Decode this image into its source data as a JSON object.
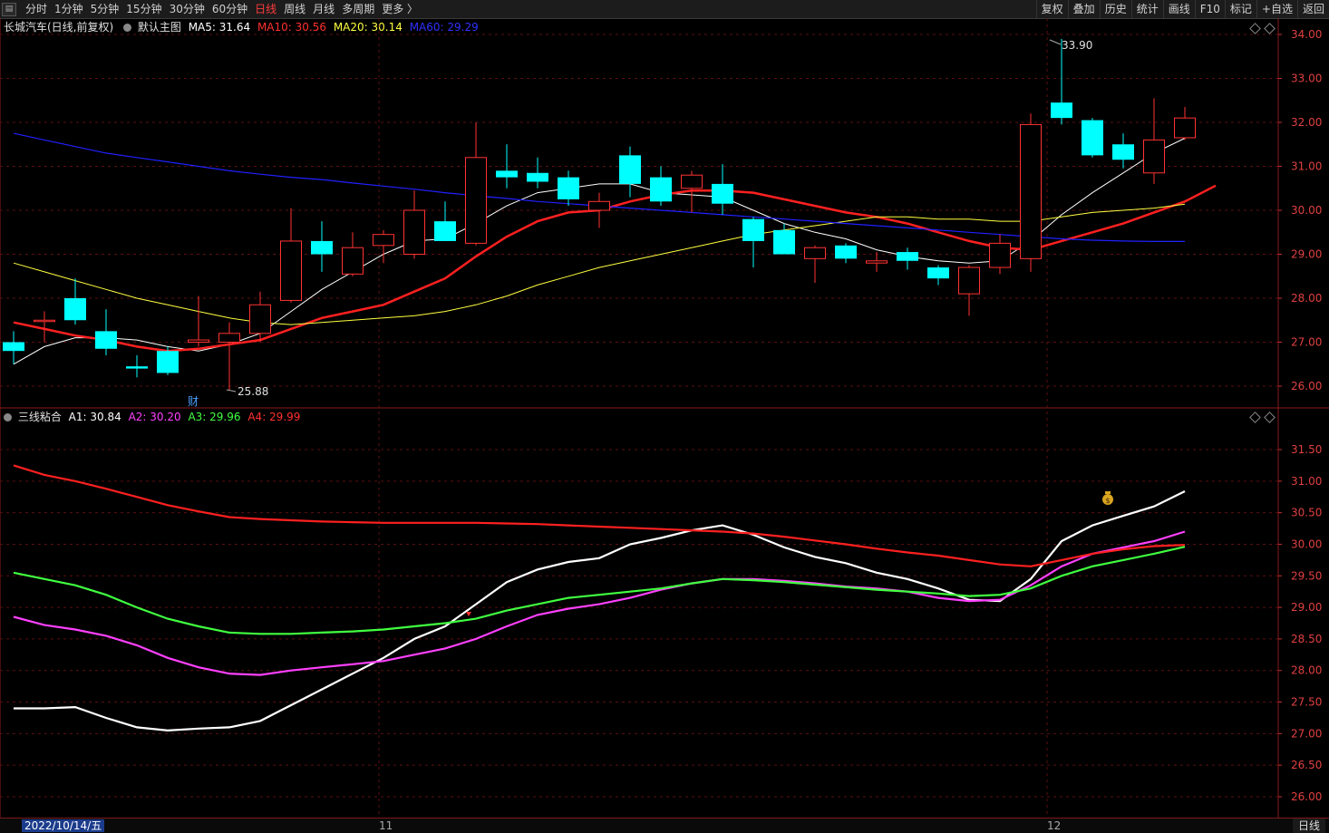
{
  "menu_icon": "grid-menu-icon",
  "period_tabs": [
    "分时",
    "1分钟",
    "5分钟",
    "15分钟",
    "30分钟",
    "60分钟",
    "日线",
    "周线",
    "月线",
    "多周期",
    "更多 〉"
  ],
  "active_period": "日线",
  "tool_buttons": [
    "复权",
    "叠加",
    "历史",
    "统计",
    "画线",
    "F10",
    "标记",
    "+自选",
    "返回"
  ],
  "main_legend": {
    "title": "长城汽车(日线,前复权)",
    "template": "默认主图",
    "ma5": "MA5: 31.64",
    "ma10": "MA10: 30.56",
    "ma20": "MA20: 30.14",
    "ma60": "MA60: 29.29"
  },
  "indicator_legend": {
    "name": "三线粘合",
    "a1": "A1: 30.84",
    "a2": "A2: 30.20",
    "a3": "A3: 29.96",
    "a4": "A4: 29.99"
  },
  "colors": {
    "up": "#ff3232",
    "down": "#00ffff",
    "ma5": "#ffffff",
    "ma10": "#ff2020",
    "ma20": "#ffff40",
    "ma60": "#2020ff",
    "a1": "#ffffff",
    "a2": "#ff40ff",
    "a3": "#40ff40",
    "a4": "#ff2020"
  },
  "main_axis_labels": [
    "34.00",
    "33.00",
    "32.00",
    "31.00",
    "30.00",
    "29.00",
    "28.00",
    "27.00",
    "26.00"
  ],
  "indicator_axis_labels": [
    "31.50",
    "31.00",
    "30.50",
    "30.00",
    "29.50",
    "29.00",
    "28.50",
    "28.00",
    "27.50",
    "27.00",
    "26.50",
    "26.00"
  ],
  "annotations": {
    "high": "33.90",
    "low": "25.88",
    "finance_marker": "财"
  },
  "date_bar": {
    "current_date": "2022/10/14/五",
    "month_11": "11",
    "month_12": "12",
    "period": "日线"
  },
  "chart_data": [
    {
      "type": "candlestick",
      "ylim": [
        25.6,
        34.2
      ],
      "grid": true,
      "candles": [
        {
          "o": 27.0,
          "h": 27.25,
          "l": 26.5,
          "c": 26.8
        },
        {
          "o": 27.5,
          "h": 27.7,
          "l": 27.0,
          "c": 27.5
        },
        {
          "o": 28.0,
          "h": 28.45,
          "l": 27.4,
          "c": 27.5
        },
        {
          "o": 27.25,
          "h": 27.75,
          "l": 26.7,
          "c": 26.85
        },
        {
          "o": 26.45,
          "h": 26.7,
          "l": 26.2,
          "c": 26.4
        },
        {
          "o": 26.8,
          "h": 26.9,
          "l": 26.25,
          "c": 26.3
        },
        {
          "o": 27.0,
          "h": 28.05,
          "l": 26.9,
          "c": 27.05
        },
        {
          "o": 27.0,
          "h": 27.45,
          "l": 25.9,
          "c": 27.2
        },
        {
          "o": 27.2,
          "h": 28.15,
          "l": 27.0,
          "c": 27.85
        },
        {
          "o": 27.95,
          "h": 30.05,
          "l": 27.9,
          "c": 29.3
        },
        {
          "o": 29.3,
          "h": 29.75,
          "l": 28.6,
          "c": 29.0
        },
        {
          "o": 28.55,
          "h": 29.5,
          "l": 28.5,
          "c": 29.15
        },
        {
          "o": 29.2,
          "h": 29.55,
          "l": 28.8,
          "c": 29.45
        },
        {
          "o": 29.0,
          "h": 30.45,
          "l": 28.9,
          "c": 30.0
        },
        {
          "o": 29.75,
          "h": 30.2,
          "l": 29.3,
          "c": 29.3
        },
        {
          "o": 29.25,
          "h": 32.0,
          "l": 29.2,
          "c": 31.2
        },
        {
          "o": 30.9,
          "h": 31.5,
          "l": 30.5,
          "c": 30.75
        },
        {
          "o": 30.85,
          "h": 31.2,
          "l": 30.5,
          "c": 30.65
        },
        {
          "o": 30.75,
          "h": 30.9,
          "l": 30.1,
          "c": 30.25
        },
        {
          "o": 30.0,
          "h": 30.4,
          "l": 29.6,
          "c": 30.2
        },
        {
          "o": 31.25,
          "h": 31.45,
          "l": 30.3,
          "c": 30.6
        },
        {
          "o": 30.75,
          "h": 31.0,
          "l": 30.1,
          "c": 30.2
        },
        {
          "o": 30.5,
          "h": 30.9,
          "l": 29.95,
          "c": 30.8
        },
        {
          "o": 30.6,
          "h": 31.05,
          "l": 29.9,
          "c": 30.15
        },
        {
          "o": 29.8,
          "h": 29.85,
          "l": 28.7,
          "c": 29.3
        },
        {
          "o": 29.55,
          "h": 29.7,
          "l": 29.0,
          "c": 29.0
        },
        {
          "o": 28.9,
          "h": 29.2,
          "l": 28.35,
          "c": 29.15
        },
        {
          "o": 29.2,
          "h": 29.25,
          "l": 28.8,
          "c": 28.9
        },
        {
          "o": 28.8,
          "h": 29.05,
          "l": 28.6,
          "c": 28.85
        },
        {
          "o": 29.05,
          "h": 29.15,
          "l": 28.65,
          "c": 28.85
        },
        {
          "o": 28.7,
          "h": 28.75,
          "l": 28.3,
          "c": 28.45
        },
        {
          "o": 28.1,
          "h": 28.75,
          "l": 27.6,
          "c": 28.7
        },
        {
          "o": 28.7,
          "h": 29.45,
          "l": 28.55,
          "c": 29.25
        },
        {
          "o": 28.9,
          "h": 32.2,
          "l": 28.6,
          "c": 31.95
        },
        {
          "o": 32.45,
          "h": 33.9,
          "l": 31.95,
          "c": 32.1
        },
        {
          "o": 32.05,
          "h": 32.1,
          "l": 31.2,
          "c": 31.25
        },
        {
          "o": 31.5,
          "h": 31.75,
          "l": 30.95,
          "c": 31.15
        },
        {
          "o": 30.85,
          "h": 32.55,
          "l": 30.6,
          "c": 31.6
        },
        {
          "o": 31.65,
          "h": 32.35,
          "l": 31.6,
          "c": 32.1
        }
      ],
      "series": [
        {
          "name": "MA5",
          "values": [
            26.5,
            26.9,
            27.1,
            27.1,
            27.05,
            26.9,
            26.8,
            26.95,
            27.2,
            27.7,
            28.2,
            28.6,
            29.0,
            29.3,
            29.35,
            29.7,
            30.1,
            30.4,
            30.5,
            30.6,
            30.6,
            30.4,
            30.35,
            30.3,
            30.0,
            29.7,
            29.5,
            29.35,
            29.1,
            28.95,
            28.85,
            28.8,
            28.85,
            29.3,
            29.9,
            30.4,
            30.85,
            31.3,
            31.64
          ]
        },
        {
          "name": "MA10",
          "values": [
            27.45,
            27.3,
            27.15,
            27.05,
            26.9,
            26.8,
            26.85,
            26.95,
            27.05,
            27.3,
            27.55,
            27.7,
            27.85,
            28.15,
            28.45,
            28.95,
            29.4,
            29.75,
            29.95,
            30.0,
            30.2,
            30.35,
            30.45,
            30.45,
            30.4,
            30.25,
            30.1,
            29.95,
            29.85,
            29.7,
            29.5,
            29.3,
            29.15,
            29.1,
            29.3,
            29.5,
            29.7,
            29.95,
            30.2,
            30.56
          ]
        },
        {
          "name": "MA20",
          "values": [
            28.8,
            28.6,
            28.4,
            28.2,
            28.0,
            27.85,
            27.7,
            27.55,
            27.45,
            27.4,
            27.45,
            27.5,
            27.55,
            27.6,
            27.7,
            27.85,
            28.05,
            28.3,
            28.5,
            28.7,
            28.85,
            29.0,
            29.15,
            29.3,
            29.45,
            29.55,
            29.65,
            29.75,
            29.85,
            29.85,
            29.8,
            29.8,
            29.75,
            29.75,
            29.85,
            29.95,
            30.0,
            30.05,
            30.14
          ]
        },
        {
          "name": "MA60",
          "values": [
            31.75,
            31.6,
            31.45,
            31.3,
            31.2,
            31.1,
            31.0,
            30.9,
            30.82,
            30.75,
            30.7,
            30.62,
            30.55,
            30.48,
            30.4,
            30.33,
            30.27,
            30.2,
            30.15,
            30.1,
            30.05,
            30.0,
            29.95,
            29.9,
            29.85,
            29.8,
            29.75,
            29.7,
            29.65,
            29.6,
            29.55,
            29.5,
            29.45,
            29.4,
            29.35,
            29.32,
            29.3,
            29.29,
            29.29
          ]
        }
      ]
    },
    {
      "type": "line",
      "ylim": [
        25.8,
        31.9
      ],
      "grid": true,
      "series": [
        {
          "name": "A1",
          "values": [
            27.4,
            27.4,
            27.42,
            27.25,
            27.1,
            27.05,
            27.08,
            27.1,
            27.2,
            27.45,
            27.7,
            27.95,
            28.2,
            28.5,
            28.7,
            29.05,
            29.4,
            29.6,
            29.72,
            29.78,
            30.0,
            30.1,
            30.22,
            30.3,
            30.15,
            29.95,
            29.8,
            29.7,
            29.55,
            29.45,
            29.3,
            29.12,
            29.1,
            29.45,
            30.05,
            30.3,
            30.45,
            30.6,
            30.84
          ]
        },
        {
          "name": "A2",
          "values": [
            28.85,
            28.72,
            28.65,
            28.55,
            28.4,
            28.2,
            28.05,
            27.95,
            27.93,
            28.0,
            28.05,
            28.1,
            28.15,
            28.25,
            28.35,
            28.5,
            28.7,
            28.88,
            28.98,
            29.05,
            29.15,
            29.28,
            29.38,
            29.45,
            29.45,
            29.42,
            29.38,
            29.33,
            29.3,
            29.25,
            29.15,
            29.1,
            29.12,
            29.35,
            29.65,
            29.85,
            29.95,
            30.05,
            30.2
          ]
        },
        {
          "name": "A3",
          "values": [
            29.55,
            29.45,
            29.35,
            29.2,
            29.0,
            28.82,
            28.7,
            28.6,
            28.58,
            28.58,
            28.6,
            28.62,
            28.65,
            28.7,
            28.75,
            28.82,
            28.95,
            29.05,
            29.15,
            29.2,
            29.25,
            29.3,
            29.38,
            29.45,
            29.43,
            29.4,
            29.36,
            29.32,
            29.28,
            29.25,
            29.22,
            29.18,
            29.2,
            29.3,
            29.5,
            29.65,
            29.75,
            29.85,
            29.96
          ]
        },
        {
          "name": "A4",
          "values": [
            31.25,
            31.1,
            31.0,
            30.88,
            30.75,
            30.62,
            30.52,
            30.43,
            30.4,
            30.38,
            30.36,
            30.35,
            30.34,
            30.34,
            30.34,
            30.34,
            30.33,
            30.32,
            30.3,
            30.28,
            30.26,
            30.24,
            30.22,
            30.2,
            30.17,
            30.12,
            30.06,
            30.0,
            29.93,
            29.87,
            29.82,
            29.75,
            29.68,
            29.65,
            29.75,
            29.85,
            29.92,
            29.97,
            29.99
          ]
        }
      ]
    }
  ]
}
